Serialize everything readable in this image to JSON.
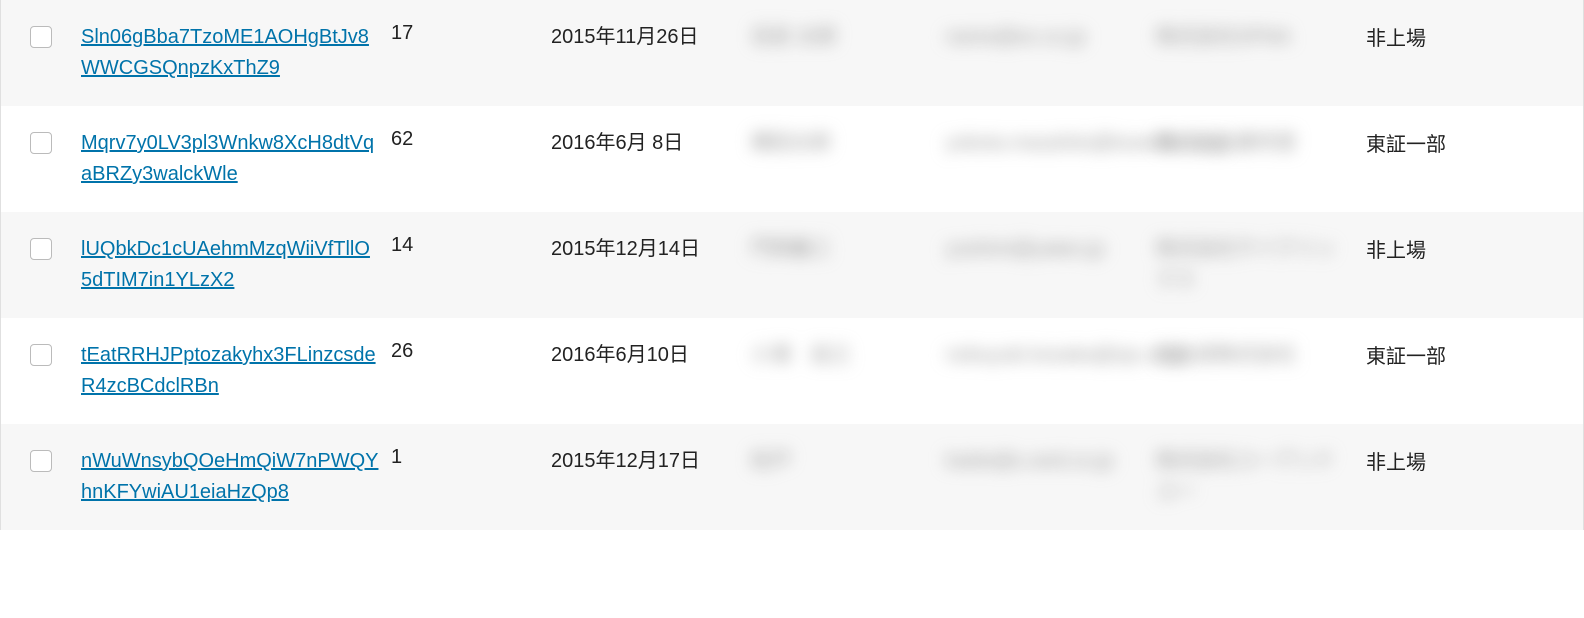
{
  "rows": [
    {
      "link": "Sln06gBba7TzoME1AOHgBtJv8WWCGSQnpzKxThZ9",
      "count": "17",
      "date": "2015年11月26日",
      "name": "名前 太郎",
      "email": "name@ex.co.jp",
      "company": "株式会社SPNA",
      "status": "非上場"
    },
    {
      "link": "Mqrv7y0LV3pl3Wnkw8XcH8dtVqaBRZy3walckWle",
      "count": "62",
      "date": "2016年6月 8日",
      "name": "横田太郎",
      "email": "yokota.masahito@koseido.co.jp",
      "company": "株式会社康世堂",
      "status": "東証一部"
    },
    {
      "link": "lUQbkDc1cUAehmMzqWiiVfTllO5dTIM7in1YLzX2",
      "count": "14",
      "date": "2015年12月14日",
      "name": "門岡義三",
      "email": "yoshimi@yateo.jp",
      "company": "株式会社サイクリックス",
      "status": "非上場"
    },
    {
      "link": "tEatRRHJPptozakyhx3FLinzcsdeR4zcBCdclRBn",
      "count": "26",
      "date": "2016年6月10日",
      "name": "小濱　延之",
      "email": "nobuyuki.kosaka@sjs.co.jp",
      "company": "旭化成株式会社",
      "status": "東証一部"
    },
    {
      "link": "nWuWnsybQOeHmQiW7nPWQYhnKFYwiAU1eiaHzQp8",
      "count": "1",
      "date": "2015年12月17日",
      "name": "松戸",
      "email": "kaido@u-and.co.jp",
      "company": "株式会社ユーアンドユー",
      "status": "非上場"
    }
  ]
}
